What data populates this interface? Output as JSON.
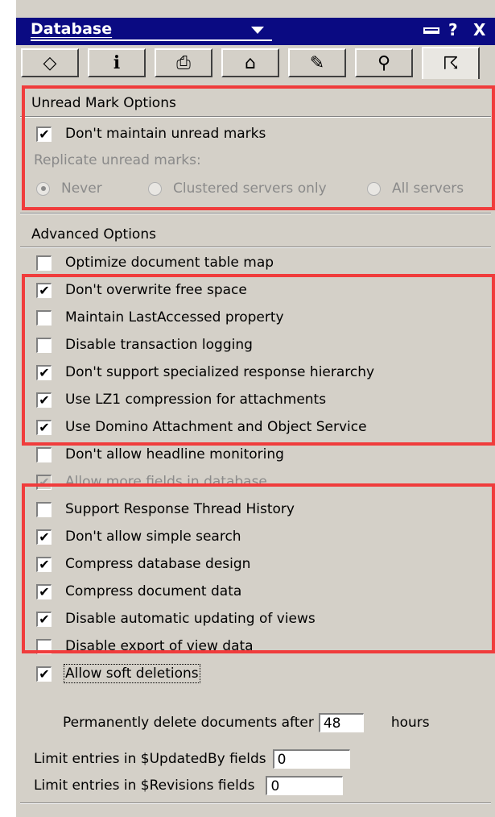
{
  "header": {
    "title": "Database",
    "help_glyph": "?",
    "close_glyph": "X"
  },
  "tabs": [
    {
      "icon": "info-disk-icon",
      "glyph": "◇"
    },
    {
      "icon": "info-icon",
      "glyph": "i"
    },
    {
      "icon": "printer-icon",
      "glyph": "⎙"
    },
    {
      "icon": "design-icon",
      "glyph": "⌂"
    },
    {
      "icon": "launch-icon",
      "glyph": "✎"
    },
    {
      "icon": "search-icon",
      "glyph": "⚲"
    },
    {
      "icon": "advanced-icon",
      "glyph": "☈"
    }
  ],
  "unread": {
    "title": "Unread Mark Options",
    "dont_maintain": {
      "label": "Don't maintain unread marks",
      "checked": true
    },
    "replicate_label": "Replicate unread marks:",
    "options": [
      {
        "label": "Never",
        "selected": true
      },
      {
        "label": "Clustered servers only",
        "selected": false
      },
      {
        "label": "All servers",
        "selected": false
      }
    ]
  },
  "advanced": {
    "title": "Advanced Options",
    "items": [
      {
        "label": "Optimize document table map",
        "checked": false,
        "disabled": false
      },
      {
        "label": "Don't overwrite free space",
        "checked": true,
        "disabled": false
      },
      {
        "label": "Maintain LastAccessed property",
        "checked": false,
        "disabled": false
      },
      {
        "label": "Disable transaction logging",
        "checked": false,
        "disabled": false
      },
      {
        "label": "Don't support specialized response hierarchy",
        "checked": true,
        "disabled": false
      },
      {
        "label": "Use LZ1 compression for attachments",
        "checked": true,
        "disabled": false
      },
      {
        "label": "Use Domino Attachment and Object Service",
        "checked": true,
        "disabled": false
      },
      {
        "label": "Don't allow headline monitoring",
        "checked": false,
        "disabled": false
      },
      {
        "label": "Allow more fields in database",
        "checked": true,
        "disabled": true
      },
      {
        "label": "Support Response Thread History",
        "checked": false,
        "disabled": false
      },
      {
        "label": "Don't allow simple search",
        "checked": true,
        "disabled": false
      },
      {
        "label": "Compress database design",
        "checked": true,
        "disabled": false
      },
      {
        "label": "Compress document data",
        "checked": true,
        "disabled": false
      },
      {
        "label": "Disable automatic updating of views",
        "checked": true,
        "disabled": false
      },
      {
        "label": "Disable export of view data",
        "checked": false,
        "disabled": false
      },
      {
        "label": "Allow soft deletions",
        "checked": true,
        "disabled": false
      }
    ],
    "delete_after_label": "Permanently delete documents after",
    "delete_after_value": "48",
    "hours_label": "hours",
    "updatedby_label": "Limit entries in $UpdatedBy fields",
    "updatedby_value": "0",
    "revisions_label": "Limit entries in $Revisions fields",
    "revisions_value": "0"
  },
  "check_glyph": "✔",
  "highlight_color": "#f03c3c"
}
